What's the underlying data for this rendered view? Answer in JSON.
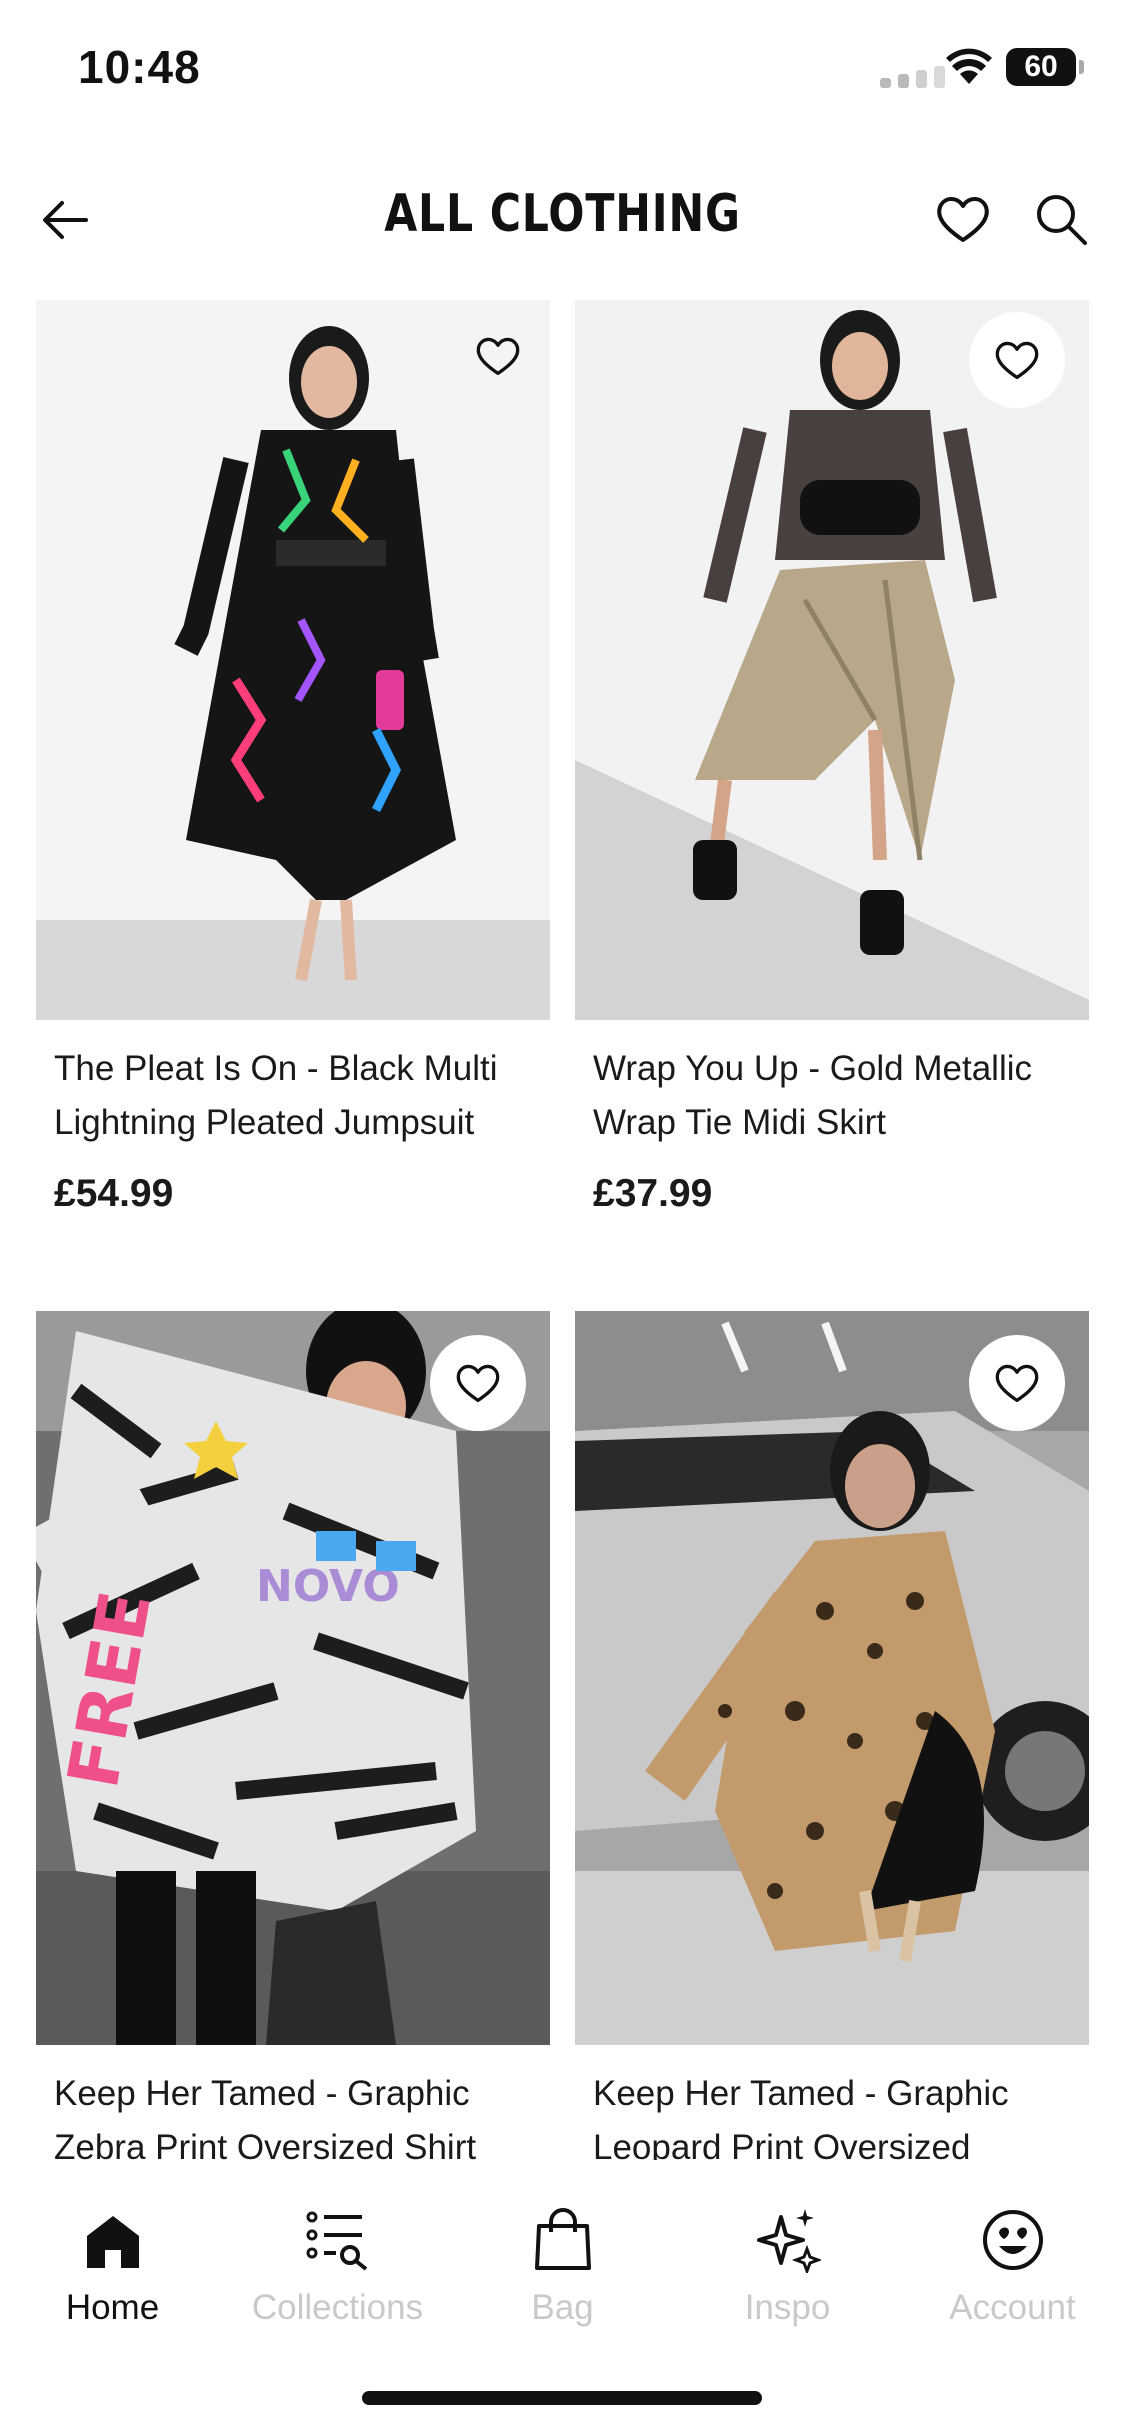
{
  "status_bar": {
    "time": "10:48",
    "battery": "60"
  },
  "header": {
    "title": "ALL CLOTHING"
  },
  "products": [
    {
      "name": "The Pleat Is On - Black Multi Lightning Pleated Jumpsuit",
      "price": "£54.99"
    },
    {
      "name": "Wrap You Up - Gold Metallic Wrap Tie Midi Skirt",
      "price": "£37.99"
    },
    {
      "name": "Keep Her Tamed - Graphic Zebra Print Oversized Shirt",
      "price": ""
    },
    {
      "name": "Keep Her Tamed - Graphic Leopard Print Oversized",
      "price": ""
    }
  ],
  "tabs": [
    {
      "label": "Home",
      "icon": "home-icon",
      "active": true
    },
    {
      "label": "Collections",
      "icon": "collections-icon",
      "active": false
    },
    {
      "label": "Bag",
      "icon": "bag-icon",
      "active": false
    },
    {
      "label": "Inspo",
      "icon": "sparkle-icon",
      "active": false
    },
    {
      "label": "Account",
      "icon": "smiley-icon",
      "active": false
    }
  ],
  "colors": {
    "accent": "#111111",
    "inactive_tab": "#c9c9c9"
  }
}
